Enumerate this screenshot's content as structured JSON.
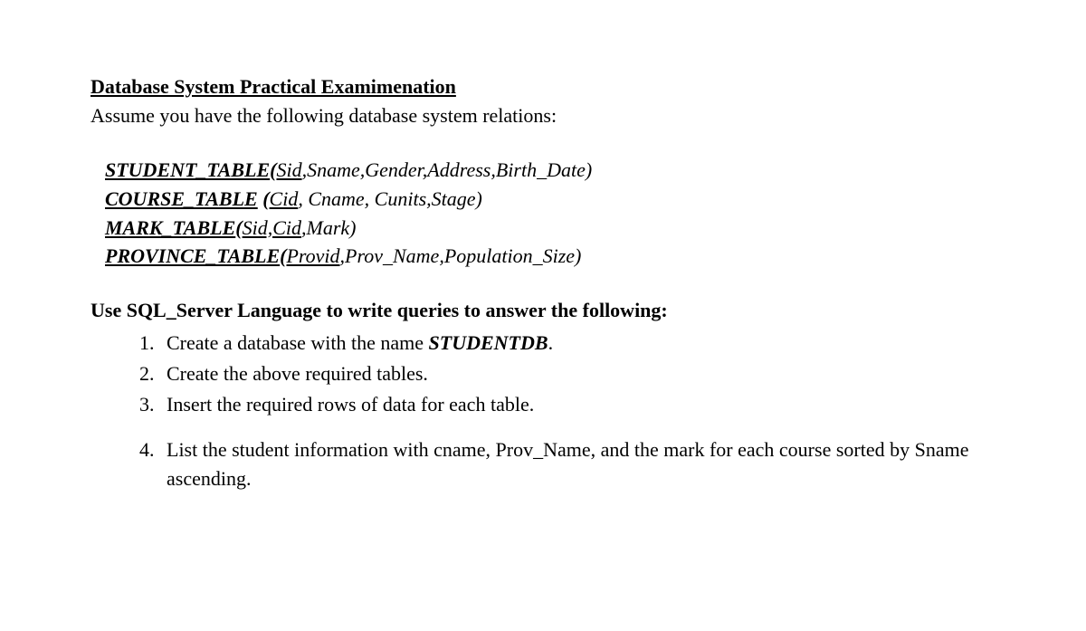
{
  "title": "Database System Practical Examimenation",
  "intro": "Assume you have the following database system relations:",
  "relations": [
    {
      "table": "STUDENT_TABLE",
      "key": "Sid",
      "rest": ",Sname,Gender,Address,Birth_Date)"
    },
    {
      "table": "COURSE_TABLE",
      "key": "Cid",
      "rest": ", Cname, Cunits,Stage)",
      "space": " "
    },
    {
      "table": "MARK_TABLE",
      "key": "Sid,Cid",
      "rest": ",Mark)"
    },
    {
      "table": "PROVINCE_TABLE",
      "key": "Provid",
      "rest": ",Prov_Name,Population_Size)"
    }
  ],
  "instruction": "Use SQL_Server Language to write queries to answer the following:",
  "questions": {
    "q1_pre": "Create a database with the name ",
    "q1_bold": "STUDENTDB",
    "q1_post": ".",
    "q2": "Create the above required tables.",
    "q3": "Insert the required rows of data for each table.",
    "q4": "List the student information with cname, Prov_Name, and the mark for each course sorted by Sname ascending."
  }
}
